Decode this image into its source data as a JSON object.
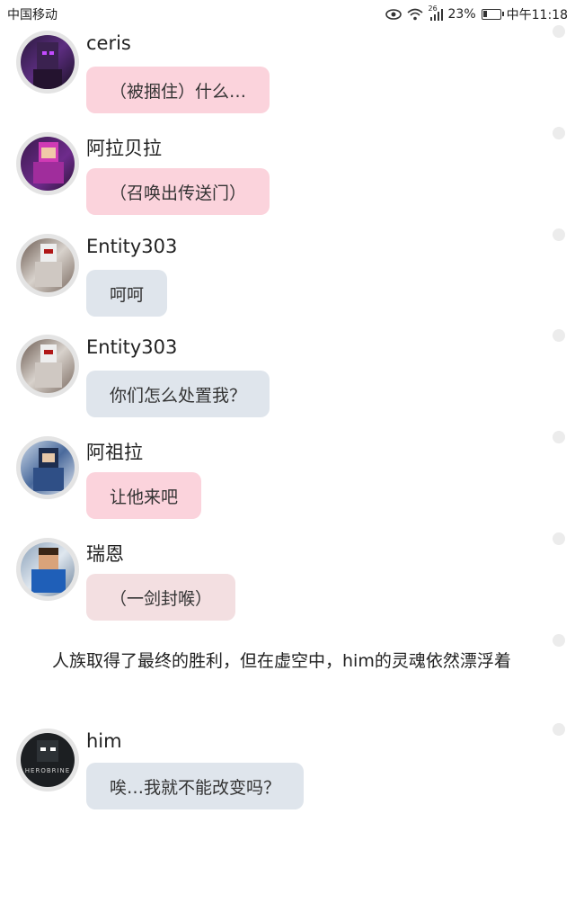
{
  "status_bar": {
    "carrier": "中国移动",
    "network": "26",
    "battery_percent": "23%",
    "battery_level": 0.23,
    "time": "中午11:18"
  },
  "messages": [
    {
      "name": "ceris",
      "text": "（被捆住）什么…",
      "style": "pink"
    },
    {
      "name": "阿拉贝拉",
      "text": "（召唤出传送门）",
      "style": "pink"
    },
    {
      "name": "Entity303",
      "text": "呵呵",
      "style": "gray"
    },
    {
      "name": "Entity303",
      "text": "你们怎么处置我？",
      "style": "gray"
    },
    {
      "name": "阿祖拉",
      "text": "让他来吧",
      "style": "pink"
    },
    {
      "name": "瑞恩",
      "text": "（一剑封喉）",
      "style": "rose"
    }
  ],
  "narration": "人族取得了最终的胜利，但在虚空中，him的灵魂依然漂浮着",
  "final_message": {
    "name": "him",
    "text": "唉…我就不能改变吗？",
    "style": "gray",
    "avatar_caption": "HEROBRINE"
  },
  "colors": {
    "pink_bubble": "#fbd3dc",
    "gray_bubble": "#dfe5ec",
    "rose_bubble": "#f3dfe1"
  }
}
